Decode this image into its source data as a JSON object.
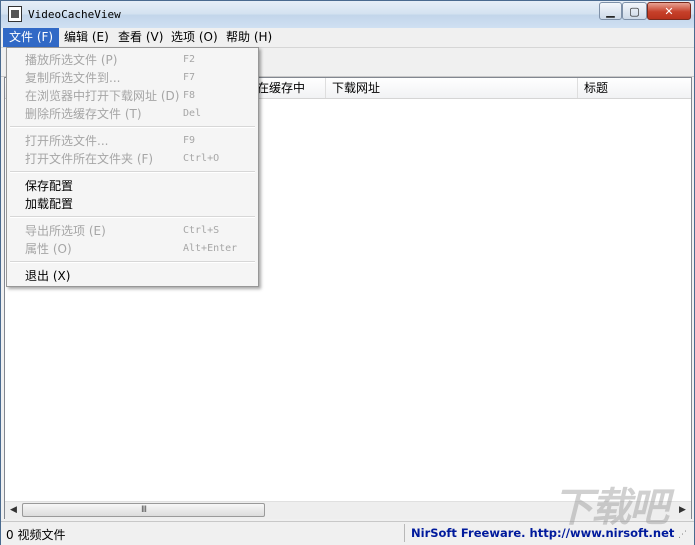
{
  "window": {
    "title": "VideoCacheView",
    "min_glyph": "▁",
    "max_glyph": "▢",
    "close_glyph": "✕"
  },
  "menubar": {
    "items": [
      "文件 (F)",
      "编辑 (E)",
      "查看 (V)",
      "选项 (O)",
      "帮助 (H)"
    ]
  },
  "columns": [
    "在缓存中",
    "下载网址",
    "标题"
  ],
  "file_menu": {
    "items": [
      {
        "label": "播放所选文件 (P)",
        "shortcut": "F2"
      },
      {
        "label": "复制所选文件到...",
        "shortcut": "F7"
      },
      {
        "label": "在浏览器中打开下载网址 (D)",
        "shortcut": "F8"
      },
      {
        "label": "删除所选缓存文件 (T)",
        "shortcut": "Del"
      },
      {
        "label": "打开所选文件...",
        "shortcut": "F9"
      },
      {
        "label": "打开文件所在文件夹 (F)",
        "shortcut": "Ctrl+O"
      },
      {
        "label": "保存配置",
        "shortcut": ""
      },
      {
        "label": "加载配置",
        "shortcut": ""
      },
      {
        "label": "导出所选项 (E)",
        "shortcut": "Ctrl+S"
      },
      {
        "label": "属性 (O)",
        "shortcut": "Alt+Enter"
      },
      {
        "label": "退出 (X)",
        "shortcut": ""
      }
    ]
  },
  "scrollbar": {
    "left_arrow": "◀",
    "right_arrow": "▶",
    "thumb_grip": "III"
  },
  "status": {
    "left": "0 视频文件",
    "right": "NirSoft Freeware.  http://www.nirsoft.net",
    "grip": "⋰"
  },
  "watermark": {
    "text": "下载吧"
  }
}
